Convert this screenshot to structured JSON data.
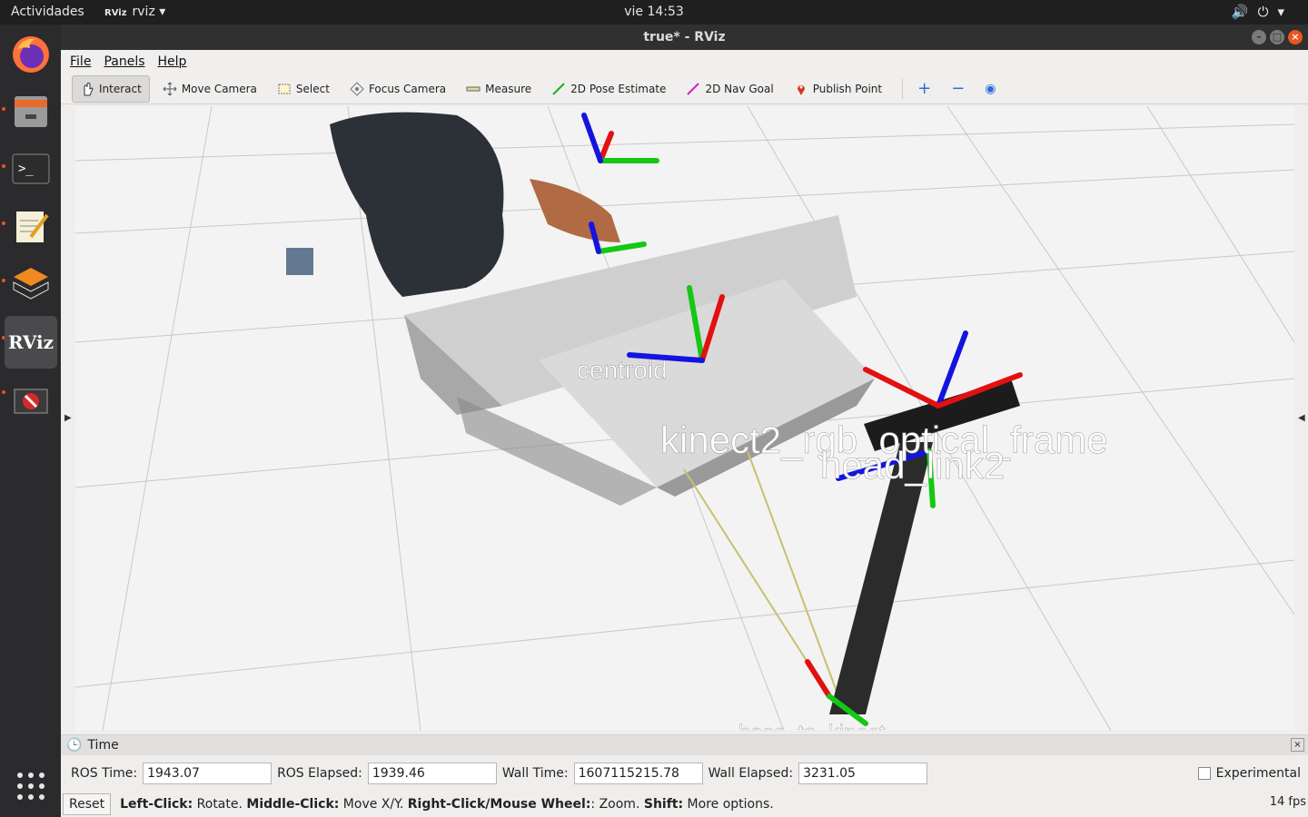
{
  "topbar": {
    "activities": "Actividades",
    "app_name": "rviz",
    "clock": "vie 14:53",
    "tray_icons": [
      "volume-icon",
      "power-icon",
      "chevron-down-icon"
    ]
  },
  "dock": {
    "items": [
      "firefox-icon",
      "files-icon",
      "terminal-icon",
      "text-editor-icon",
      "ros-qt-icon",
      "rviz-icon",
      "no-entry-icon",
      "apps-grid-icon"
    ]
  },
  "window": {
    "title": "true* - RViz"
  },
  "menu": {
    "file": "File",
    "panels": "Panels",
    "help": "Help"
  },
  "toolbar": {
    "interact": "Interact",
    "move_camera": "Move Camera",
    "select": "Select",
    "focus_camera": "Focus Camera",
    "measure": "Measure",
    "pose_estimate": "2D Pose Estimate",
    "nav_goal": "2D Nav Goal",
    "publish_point": "Publish Point"
  },
  "viewport": {
    "labels": {
      "centroid": "centroid",
      "kinect_frame": "kinect2_rgb_optical_frame",
      "head_link": "head_link2",
      "base_to_kinect": "base_to_kinect"
    },
    "colors": {
      "x_axis": "#e31010",
      "y_axis": "#14c814",
      "z_axis": "#1414e0",
      "laser_line": "#c8c070",
      "robot_link": "#2b2b2b"
    }
  },
  "time_panel": {
    "title": "Time",
    "ros_time_label": "ROS Time:",
    "ros_time": "1943.07",
    "ros_elapsed_label": "ROS Elapsed:",
    "ros_elapsed": "1939.46",
    "wall_time_label": "Wall Time:",
    "wall_time": "1607115215.78",
    "wall_elapsed_label": "Wall Elapsed:",
    "wall_elapsed": "3231.05",
    "experimental": "Experimental"
  },
  "status": {
    "reset": "Reset",
    "left_click_key": "Left-Click:",
    "left_click_val": " Rotate. ",
    "middle_click_key": "Middle-Click:",
    "middle_click_val": " Move X/Y. ",
    "right_click_key": "Right-Click/Mouse Wheel:",
    "right_click_val": ": Zoom. ",
    "shift_key": "Shift:",
    "shift_val": " More options.",
    "fps": "14 fps"
  }
}
